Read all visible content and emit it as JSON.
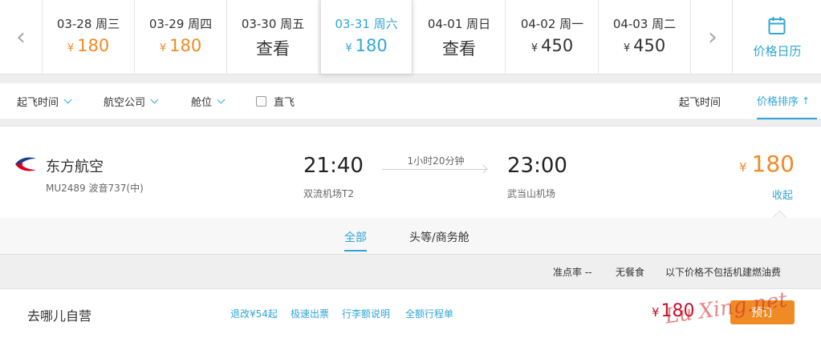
{
  "date_strip": {
    "prev_arrow": "‹",
    "next_arrow": "›",
    "dates": [
      {
        "date": "03-28 周三",
        "price": "180",
        "currency": "¥",
        "orange": true
      },
      {
        "date": "03-29 周四",
        "price": "180",
        "currency": "¥",
        "orange": true
      },
      {
        "date": "03-30 周五",
        "price": "查看",
        "currency": "",
        "orange": false
      },
      {
        "date": "03-31 周六",
        "price": "180",
        "currency": "¥",
        "orange": false,
        "active": true
      },
      {
        "date": "04-01 周日",
        "price": "查看",
        "currency": "",
        "orange": false
      },
      {
        "date": "04-02 周一",
        "price": "450",
        "currency": "¥",
        "orange": false
      },
      {
        "date": "04-03 周二",
        "price": "450",
        "currency": "¥",
        "orange": false
      }
    ],
    "calendar_label": "价格日历"
  },
  "filters": {
    "departure_time": "起飞时间",
    "airline": "航空公司",
    "cabin": "舱位",
    "direct": "直飞",
    "sort_departure": "起飞时间",
    "sort_price": "价格排序",
    "sort_arrow": "🡑"
  },
  "flight": {
    "airline": "东方航空",
    "flight_info": "MU2489 波音737(中)",
    "dep_time": "21:40",
    "dep_airport": "双流机场T2",
    "duration": "1小时20分钟",
    "arr_time": "23:00",
    "arr_airport": "武当山机场",
    "currency": "¥",
    "price": "180",
    "collapse": "收起"
  },
  "cabin_tabs": {
    "all": "全部",
    "first_business": "头等/商务舱"
  },
  "notes": {
    "ontime": "准点率 --",
    "meal": "无餐食",
    "fuel": "以下价格不包括机建燃油费"
  },
  "offer": {
    "vendor": "去哪儿自营",
    "links": [
      "退改¥54起",
      "极速出票",
      "行李额说明",
      "全额行程单"
    ],
    "currency": "¥",
    "price": "180",
    "book": "预订"
  },
  "watermark": "Lu Xing.net",
  "colors": {
    "accent": "#2fa6d8",
    "price_orange": "#f08a24",
    "offer_red": "#c8102e"
  }
}
